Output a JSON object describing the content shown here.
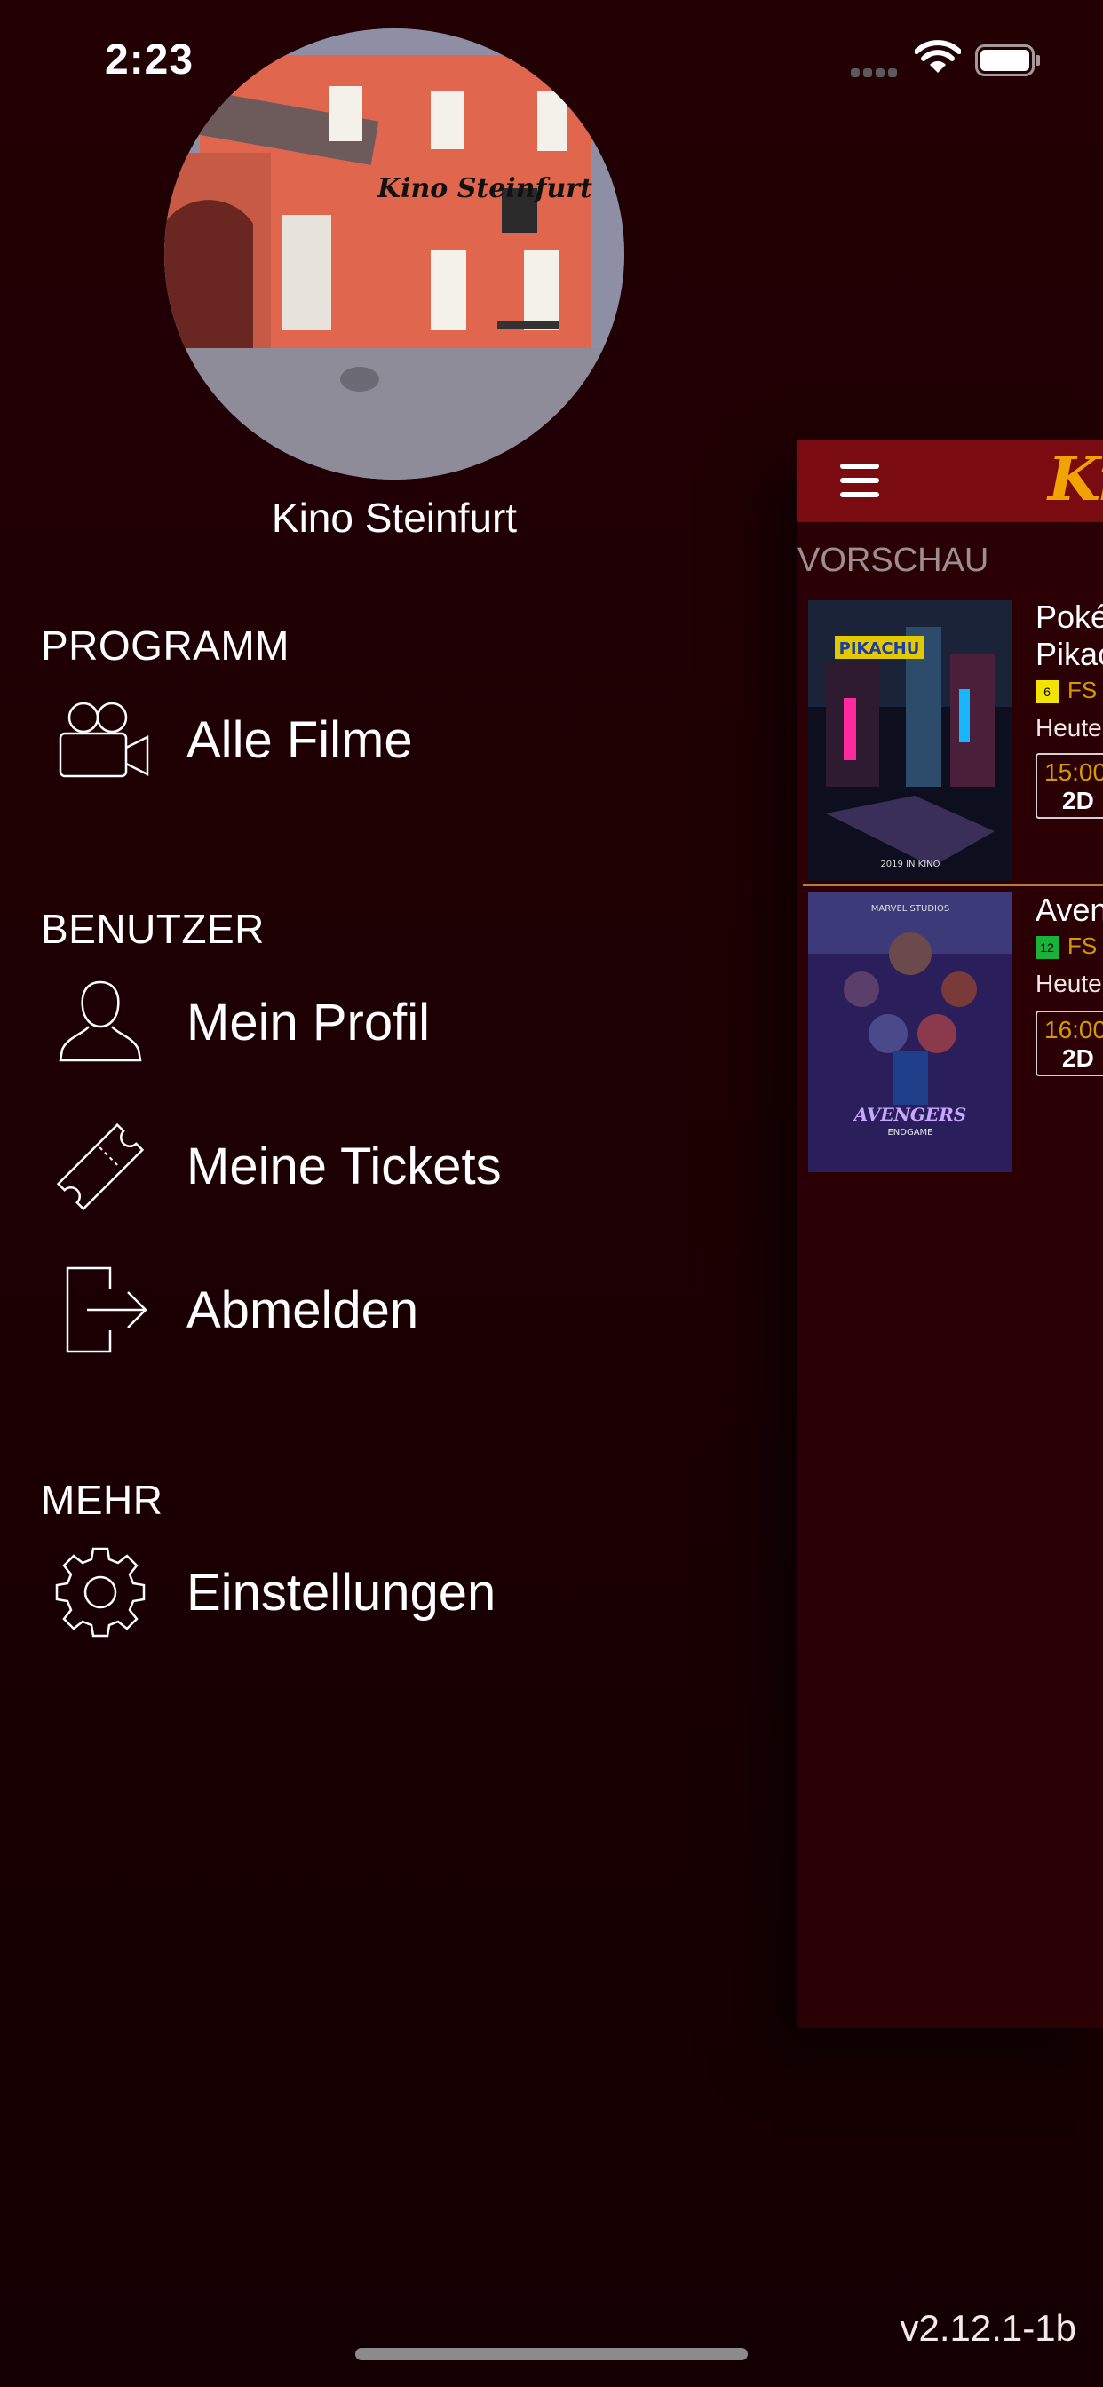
{
  "status_bar": {
    "time": "2:23"
  },
  "profile": {
    "venue_name": "Kino Steinfurt",
    "photo_sign_text": "Kino Steinfurt"
  },
  "menu": {
    "sections": [
      {
        "label": "PROGRAMM",
        "items": [
          {
            "label": "Alle Filme",
            "icon": "video-camera-icon"
          }
        ]
      },
      {
        "label": "BENUTZER",
        "items": [
          {
            "label": "Mein Profil",
            "icon": "user-icon"
          },
          {
            "label": "Meine Tickets",
            "icon": "ticket-icon"
          },
          {
            "label": "Abmelden",
            "icon": "logout-icon"
          }
        ]
      },
      {
        "label": "MEHR",
        "items": [
          {
            "label": "Einstellungen",
            "icon": "gear-icon"
          }
        ]
      }
    ]
  },
  "version": "v2.12.1-1b",
  "main_view": {
    "logo_fragment": "Kin",
    "section_label": "VORSCHAU",
    "films": [
      {
        "title_lines": [
          "Poké",
          "Pikac"
        ],
        "fsk_badge": "6",
        "fsk_text": "FS",
        "day": "Heute",
        "time": "15:00",
        "format": "2D",
        "poster_texts": [
          "PIKACHU",
          "2019 IN KINO"
        ]
      },
      {
        "title_lines": [
          "Aven"
        ],
        "fsk_badge": "12",
        "fsk_text": "FS",
        "day": "Heute",
        "time": "16:00",
        "format": "2D",
        "poster_texts": [
          "AVENGERS",
          "ENDGAME",
          "MARVEL STUDIOS"
        ]
      }
    ]
  },
  "colors": {
    "background": "#220004",
    "header": "#7a0b10",
    "accent": "#d49a00",
    "logo": "#f2a300"
  }
}
